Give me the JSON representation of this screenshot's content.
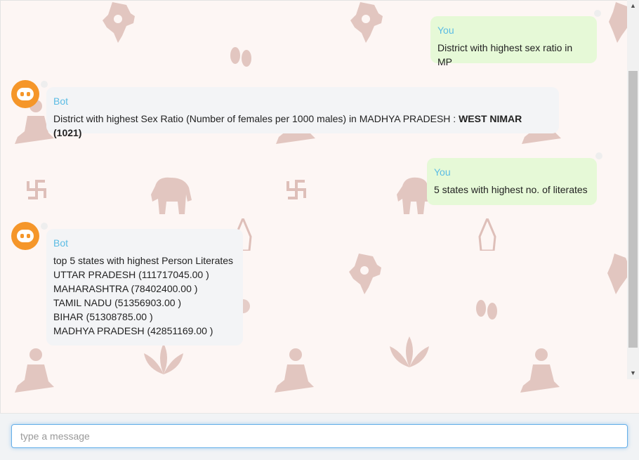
{
  "messages": [
    {
      "sender": "You",
      "text": "District with highest sex ratio in MP"
    },
    {
      "sender": "Bot",
      "text_prefix": "District with highest Sex Ratio (Number of females per 1000 males) in MADHYA PRADESH : ",
      "text_bold": "WEST NIMAR (1021)"
    },
    {
      "sender": "You",
      "text": "5 states with highest no. of literates"
    },
    {
      "sender": "Bot",
      "lines": [
        "top 5 states with highest Person Literates",
        "UTTAR PRADESH (111717045.00 )",
        "MAHARASHTRA (78402400.00 )",
        "TAMIL NADU (51356903.00 )",
        "BIHAR (51308785.00 )",
        "MADHYA PRADESH (42851169.00 )"
      ]
    }
  ],
  "input": {
    "placeholder": "type a message",
    "value": ""
  },
  "colors": {
    "user_bubble": "#e6f9d7",
    "bot_bubble": "#f3f4f6",
    "sender_label": "#5bbce4",
    "avatar": "#f5962a",
    "wallpaper_motif": "#d6b2aa"
  },
  "icons": [
    "bot-avatar-icon",
    "india-map-motif",
    "swastika-motif",
    "elephant-motif",
    "lotus-motif",
    "namaste-hands-motif",
    "yoga-figure-motif",
    "footprints-motif"
  ]
}
